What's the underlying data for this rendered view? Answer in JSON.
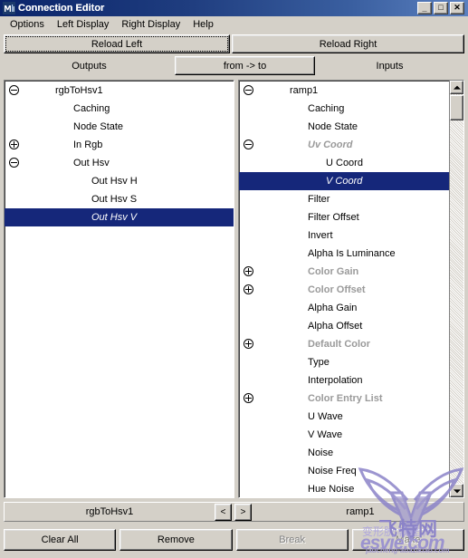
{
  "window": {
    "title": "Connection Editor",
    "icon": "maya-app-icon",
    "controls": {
      "minimize": "_",
      "maximize": "□",
      "close": "✕"
    }
  },
  "menubar": {
    "items": [
      {
        "label": "Options"
      },
      {
        "label": "Left Display"
      },
      {
        "label": "Right Display"
      },
      {
        "label": "Help"
      }
    ]
  },
  "toolbar": {
    "reload_left": "Reload Left",
    "reload_right": "Reload Right"
  },
  "columns": {
    "outputs": "Outputs",
    "direction": "from -> to",
    "inputs": "Inputs"
  },
  "left_tree": {
    "node_name": "rgbToHsv1",
    "rows": [
      {
        "label": "rgbToHsv1",
        "indent": 0,
        "expander": "minus",
        "state": "normal",
        "selected": false
      },
      {
        "label": "Caching",
        "indent": 1,
        "expander": "none",
        "state": "normal",
        "selected": false
      },
      {
        "label": "Node State",
        "indent": 1,
        "expander": "none",
        "state": "normal",
        "selected": false
      },
      {
        "label": "In Rgb",
        "indent": 1,
        "expander": "plus",
        "state": "normal",
        "selected": false
      },
      {
        "label": "Out Hsv",
        "indent": 1,
        "expander": "minus",
        "state": "normal",
        "selected": false
      },
      {
        "label": "Out Hsv H",
        "indent": 2,
        "expander": "none",
        "state": "normal",
        "selected": false
      },
      {
        "label": "Out Hsv S",
        "indent": 2,
        "expander": "none",
        "state": "normal",
        "selected": false
      },
      {
        "label": "Out Hsv V",
        "indent": 2,
        "expander": "none",
        "state": "italic",
        "selected": true
      }
    ]
  },
  "right_tree": {
    "node_name": "ramp1",
    "rows": [
      {
        "label": "ramp1",
        "indent": 0,
        "expander": "minus",
        "state": "normal",
        "selected": false
      },
      {
        "label": "Caching",
        "indent": 1,
        "expander": "none",
        "state": "normal",
        "selected": false
      },
      {
        "label": "Node State",
        "indent": 1,
        "expander": "none",
        "state": "normal",
        "selected": false
      },
      {
        "label": "Uv Coord",
        "indent": 1,
        "expander": "minus",
        "state": "dim-italic",
        "selected": false
      },
      {
        "label": "U Coord",
        "indent": 2,
        "expander": "none",
        "state": "normal",
        "selected": false
      },
      {
        "label": "V Coord",
        "indent": 2,
        "expander": "none",
        "state": "italic",
        "selected": true
      },
      {
        "label": "Filter",
        "indent": 1,
        "expander": "none",
        "state": "normal",
        "selected": false
      },
      {
        "label": "Filter Offset",
        "indent": 1,
        "expander": "none",
        "state": "normal",
        "selected": false
      },
      {
        "label": "Invert",
        "indent": 1,
        "expander": "none",
        "state": "normal",
        "selected": false
      },
      {
        "label": "Alpha Is Luminance",
        "indent": 1,
        "expander": "none",
        "state": "normal",
        "selected": false
      },
      {
        "label": "Color Gain",
        "indent": 1,
        "expander": "plus",
        "state": "dim",
        "selected": false
      },
      {
        "label": "Color Offset",
        "indent": 1,
        "expander": "plus",
        "state": "dim",
        "selected": false
      },
      {
        "label": "Alpha Gain",
        "indent": 1,
        "expander": "none",
        "state": "normal",
        "selected": false
      },
      {
        "label": "Alpha Offset",
        "indent": 1,
        "expander": "none",
        "state": "normal",
        "selected": false
      },
      {
        "label": "Default Color",
        "indent": 1,
        "expander": "plus",
        "state": "dim",
        "selected": false
      },
      {
        "label": "Type",
        "indent": 1,
        "expander": "none",
        "state": "normal",
        "selected": false
      },
      {
        "label": "Interpolation",
        "indent": 1,
        "expander": "none",
        "state": "normal",
        "selected": false
      },
      {
        "label": "Color Entry List",
        "indent": 1,
        "expander": "plus",
        "state": "dim",
        "selected": false
      },
      {
        "label": "U Wave",
        "indent": 1,
        "expander": "none",
        "state": "normal",
        "selected": false
      },
      {
        "label": "V Wave",
        "indent": 1,
        "expander": "none",
        "state": "normal",
        "selected": false
      },
      {
        "label": "Noise",
        "indent": 1,
        "expander": "none",
        "state": "normal",
        "selected": false
      },
      {
        "label": "Noise Freq",
        "indent": 1,
        "expander": "none",
        "state": "normal",
        "selected": false
      },
      {
        "label": "Hue Noise",
        "indent": 1,
        "expander": "none",
        "state": "normal",
        "selected": false
      }
    ]
  },
  "navigation": {
    "prev": "<",
    "next": ">"
  },
  "actions": [
    {
      "label": "Clear All",
      "disabled": false
    },
    {
      "label": "Remove",
      "disabled": false
    },
    {
      "label": "Break",
      "disabled": true
    },
    {
      "label": "Make",
      "disabled": true
    }
  ],
  "watermark": {
    "logo": "purple-wings-v-logo",
    "text_cn": "飞特网",
    "text_cn_small": "变形脱 教程 网",
    "text_site": "esvie.com",
    "text_url": "jaucheng-abaziklao.com"
  },
  "colors": {
    "selection": "#15277a",
    "titlebar_start": "#0a246a",
    "titlebar_end": "#5b80bf",
    "face": "#d4d0c8",
    "dim_text": "#9a9a9a"
  }
}
